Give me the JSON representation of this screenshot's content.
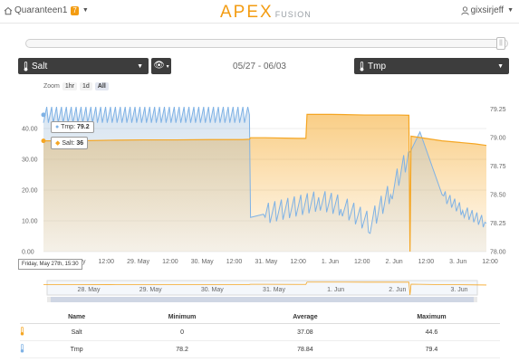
{
  "header": {
    "account_name": "Quaranteen1",
    "badge_count": "7",
    "brand_main": "APEX",
    "brand_sub": "FUSION",
    "user_name": "gixsirjeff"
  },
  "controls": {
    "left_probe": "Salt",
    "right_probe": "Tmp",
    "date_range": "05/27 - 06/03",
    "zoom_label": "Zoom",
    "zoom_options": [
      "1hr",
      "1d",
      "All"
    ],
    "zoom_selected": "All"
  },
  "tooltip": {
    "tmp_label": "Tmp:",
    "tmp_value": "79.2",
    "salt_label": "Salt:",
    "salt_value": "36",
    "date": "Friday, May 27th, 15:30"
  },
  "colors": {
    "salt": "#f5a623",
    "tmp": "#7fb2e5",
    "accent": "#f39c12"
  },
  "chart_data": {
    "type": "line",
    "left_axis": {
      "ticks": [
        "0.00",
        "10.00",
        "20.00",
        "30.00",
        "40.00"
      ],
      "range": [
        0,
        50
      ]
    },
    "right_axis": {
      "ticks": [
        "78.00",
        "78.25",
        "78.50",
        "78.75",
        "79.00",
        "79.25"
      ],
      "range": [
        78.0,
        79.35
      ]
    },
    "x_ticks": [
      "28. May",
      "12:00",
      "29. May",
      "12:00",
      "30. May",
      "12:00",
      "31. May",
      "12:00",
      "1. Jun",
      "12:00",
      "2. Jun",
      "12:00",
      "3. Jun",
      "12:00"
    ],
    "navigator_ticks": [
      "28. May",
      "29. May",
      "30. May",
      "31. May",
      "1. Jun",
      "2. Jun",
      "3. Jun"
    ],
    "series": [
      {
        "name": "Salt",
        "axis": "left",
        "x": [
          0.0,
          0.6,
          1.2,
          1.8,
          2.4,
          3.0,
          3.6,
          3.72,
          3.74,
          4.0,
          4.6,
          4.74,
          4.76,
          5.2,
          5.8,
          6.4,
          6.6,
          6.62,
          6.64,
          7.2,
          7.8,
          8.0
        ],
        "values": [
          36,
          36,
          36.2,
          36.3,
          36.3,
          36.4,
          36.4,
          36.5,
          37,
          37,
          36.8,
          36.8,
          44.6,
          44.6,
          44.4,
          44.4,
          44.3,
          0,
          37.5,
          36,
          35,
          34.5
        ]
      },
      {
        "name": "Tmp",
        "axis": "right",
        "x": [
          0.0,
          3.72,
          3.74,
          5.0,
          5.4,
          5.9,
          6.3,
          6.8,
          7.2,
          7.6,
          8.0
        ],
        "values": [
          79.2,
          79.2,
          78.3,
          78.45,
          78.4,
          78.25,
          78.55,
          79.05,
          78.5,
          78.35,
          78.25
        ]
      }
    ]
  },
  "table": {
    "headers": [
      "Name",
      "Minimum",
      "Average",
      "Maximum"
    ],
    "rows": [
      {
        "name": "Salt",
        "min": "0",
        "avg": "37.08",
        "max": "44.6"
      },
      {
        "name": "Tmp",
        "min": "78.2",
        "avg": "78.84",
        "max": "79.4"
      }
    ]
  }
}
